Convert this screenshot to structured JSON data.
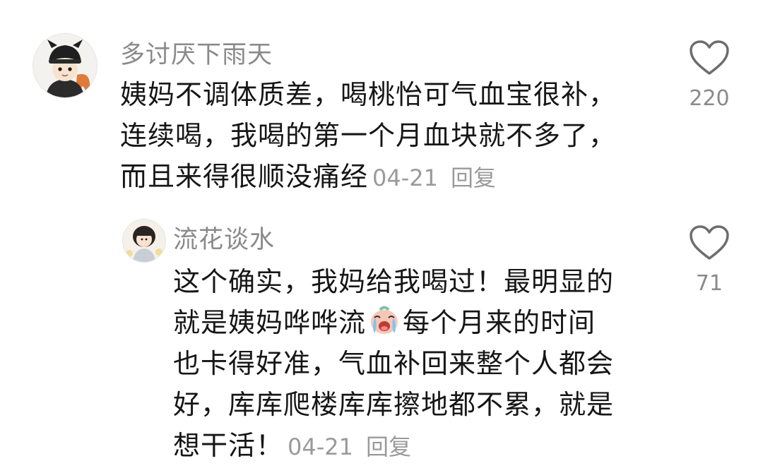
{
  "comments": [
    {
      "username": "多讨厌下雨天",
      "lines": [
        "姨妈不调体质差，喝桃怡可气血宝很补，",
        "连续喝，我喝的第一个月血块就不多了，",
        "而且来得很顺没痛经"
      ],
      "date": "04-21",
      "reply_label": "回复",
      "likes": "220",
      "avatar_icon": "fox-hat-cartoon-avatar",
      "like_icon": "heart-outline-icon"
    },
    {
      "username": "流花谈水",
      "lines_before_emoji": [
        "这个确实，我妈给我喝过！最明显的",
        "就是姨妈哗哗流"
      ],
      "emoji_icon": "crying-face-emoji",
      "line_after_emoji": "每个月来的时间",
      "lines_after": [
        "也卡得好准，气血补回来整个人都会",
        "好，库库爬楼库库擦地都不累，就是",
        "想干活！"
      ],
      "date": "04-21",
      "reply_label": "回复",
      "likes": "71",
      "avatar_icon": "girl-with-buns-avatar",
      "like_icon": "heart-outline-icon"
    }
  ],
  "colors": {
    "text": "#161616",
    "secondary": "#8a8a8a",
    "meta": "#9a9a9a",
    "background": "#ffffff"
  }
}
